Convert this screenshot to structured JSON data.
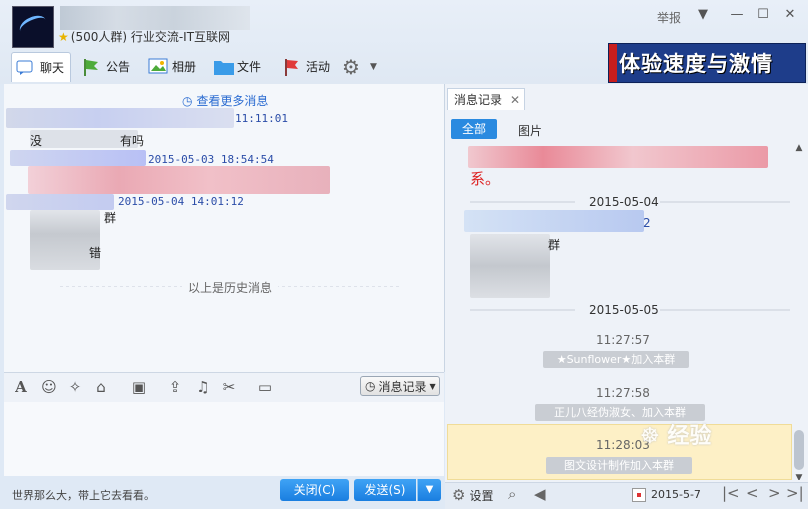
{
  "header": {
    "group_title": "(500人群) 行业交流-IT互联网",
    "report_label": "举报",
    "banner_text": "体验速度与激情"
  },
  "tabs": [
    {
      "label": "聊天"
    },
    {
      "label": "公告"
    },
    {
      "label": "相册"
    },
    {
      "label": "文件"
    },
    {
      "label": "活动"
    }
  ],
  "chat": {
    "view_more": "查看更多消息",
    "timestamps": [
      "11:11:01",
      "2015-05-03 18:54:54",
      "2015-05-04 14:01:12"
    ],
    "fragments": [
      "没",
      "有吗",
      "群",
      "错"
    ],
    "history_label": "以上是历史消息"
  },
  "toolbar": {
    "history_button": "消息记录"
  },
  "input": {
    "footer_text": "世界那么大，带上它去看看。",
    "close_button": "关闭(C)",
    "send_button": "发送(S)"
  },
  "history_panel": {
    "tab_label": "消息记录",
    "filters": [
      "全部",
      "图片"
    ],
    "first_text_fragment": "系。",
    "dates": [
      "2015-05-04",
      "2015-05-05"
    ],
    "inline_number": "2",
    "fragment": "群",
    "entries": [
      {
        "time": "11:27:57",
        "message": "★Sunflower★加入本群"
      },
      {
        "time": "11:27:58",
        "message": "正儿八经伪淑女、加入本群"
      },
      {
        "time": "11:28:03",
        "message": "图文设计制作加入本群"
      }
    ],
    "footer": {
      "settings_label": "设置",
      "date_value": "2015-5-7"
    },
    "watermark": "经验"
  },
  "colors": {
    "accent": "#1a7ee0",
    "link": "#2a6bd1",
    "highlight": "#fdf0c6",
    "timestamp": "#2b4da8"
  }
}
